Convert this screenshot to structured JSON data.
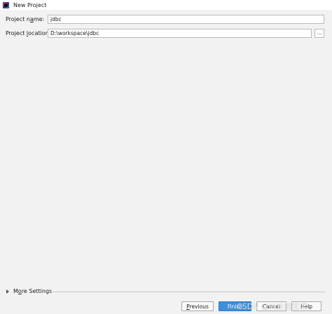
{
  "window": {
    "title": "New Project"
  },
  "form": {
    "project_name": {
      "label_pre": "Project n",
      "label_mnemonic": "a",
      "label_post": "me:",
      "value": "jdbc"
    },
    "project_location": {
      "label_pre": "Project ",
      "label_mnemonic": "l",
      "label_post": "ocation:",
      "value": "D:\\workspace\\jdbc",
      "browse_label": "..."
    }
  },
  "more_settings": {
    "label_pre": "M",
    "label_mnemonic": "o",
    "label_post": "re Settings",
    "icon": "triangle-right-icon"
  },
  "buttons": {
    "previous_pre": "",
    "previous_mnemonic": "P",
    "previous_post": "revious",
    "finish": "Finish",
    "cancel": "Cancel",
    "help": "Help"
  },
  "watermark": "CSDN @兴奋的雷鹰",
  "colors": {
    "primary_button": "#3f8fd8",
    "background": "#f2f2f2"
  }
}
